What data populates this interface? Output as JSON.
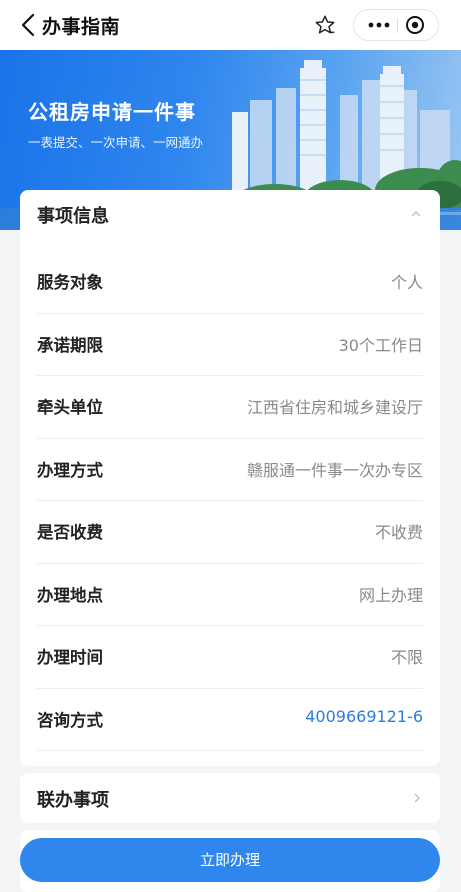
{
  "navbar": {
    "title": "办事指南",
    "back_icon": "chevron-left-icon",
    "favorite_icon": "star-icon",
    "more_icon": "more-dots-icon",
    "close_icon": "mini-program-close-icon"
  },
  "banner": {
    "title": "公租房申请一件事",
    "subtitle": "一表提交、一次申请、一网通办"
  },
  "info_card": {
    "title": "事项信息",
    "rows": [
      {
        "label": "服务对象",
        "value": "个人"
      },
      {
        "label": "承诺期限",
        "value": "30个工作日"
      },
      {
        "label": "牵头单位",
        "value": "江西省住房和城乡建设厅"
      },
      {
        "label": "办理方式",
        "value": "赣服通一件事一次办专区"
      },
      {
        "label": "是否收费",
        "value": "不收费"
      },
      {
        "label": "办理地点",
        "value": "网上办理"
      },
      {
        "label": "办理时间",
        "value": "不限"
      },
      {
        "label": "咨询方式",
        "value": "4009669121-6"
      }
    ]
  },
  "joint_card": {
    "title": "联办事项"
  },
  "action": {
    "label": "立即办理"
  },
  "colors": {
    "accent": "#2f87ee",
    "link": "#2a7de1",
    "banner_start": "#1a73e8"
  }
}
